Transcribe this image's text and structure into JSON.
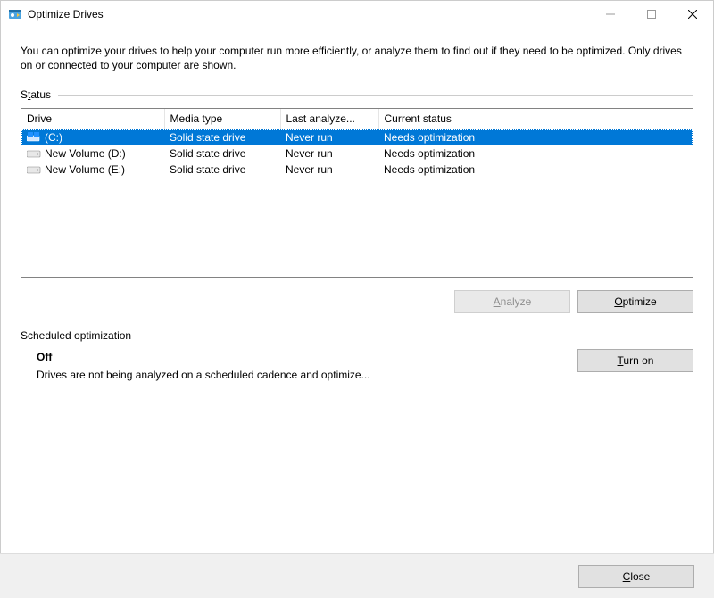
{
  "window": {
    "title": "Optimize Drives"
  },
  "description": "You can optimize your drives to help your computer run more efficiently, or analyze them to find out if they need to be optimized. Only drives on or connected to your computer are shown.",
  "status_section": {
    "label_pre": "S",
    "label_ul": "t",
    "label_post": "atus"
  },
  "table": {
    "headers": {
      "drive": "Drive",
      "media": "Media type",
      "last": "Last analyze...",
      "status": "Current status"
    },
    "rows": [
      {
        "selected": true,
        "icon": "drive-os",
        "name": "(C:)",
        "media": "Solid state drive",
        "last": "Never run",
        "status": "Needs optimization"
      },
      {
        "selected": false,
        "icon": "drive-hdd",
        "name": "New Volume (D:)",
        "media": "Solid state drive",
        "last": "Never run",
        "status": "Needs optimization"
      },
      {
        "selected": false,
        "icon": "drive-hdd",
        "name": "New Volume (E:)",
        "media": "Solid state drive",
        "last": "Never run",
        "status": "Needs optimization"
      }
    ]
  },
  "buttons": {
    "analyze_ul": "A",
    "analyze_rest": "nalyze",
    "optimize_ul": "O",
    "optimize_rest": "ptimize",
    "turnon_ul": "T",
    "turnon_rest": "urn on",
    "close_ul": "C",
    "close_rest": "lose"
  },
  "sched_section": {
    "label": "Scheduled optimization",
    "state": "Off",
    "detail": "Drives are not being analyzed on a scheduled cadence and optimize..."
  }
}
